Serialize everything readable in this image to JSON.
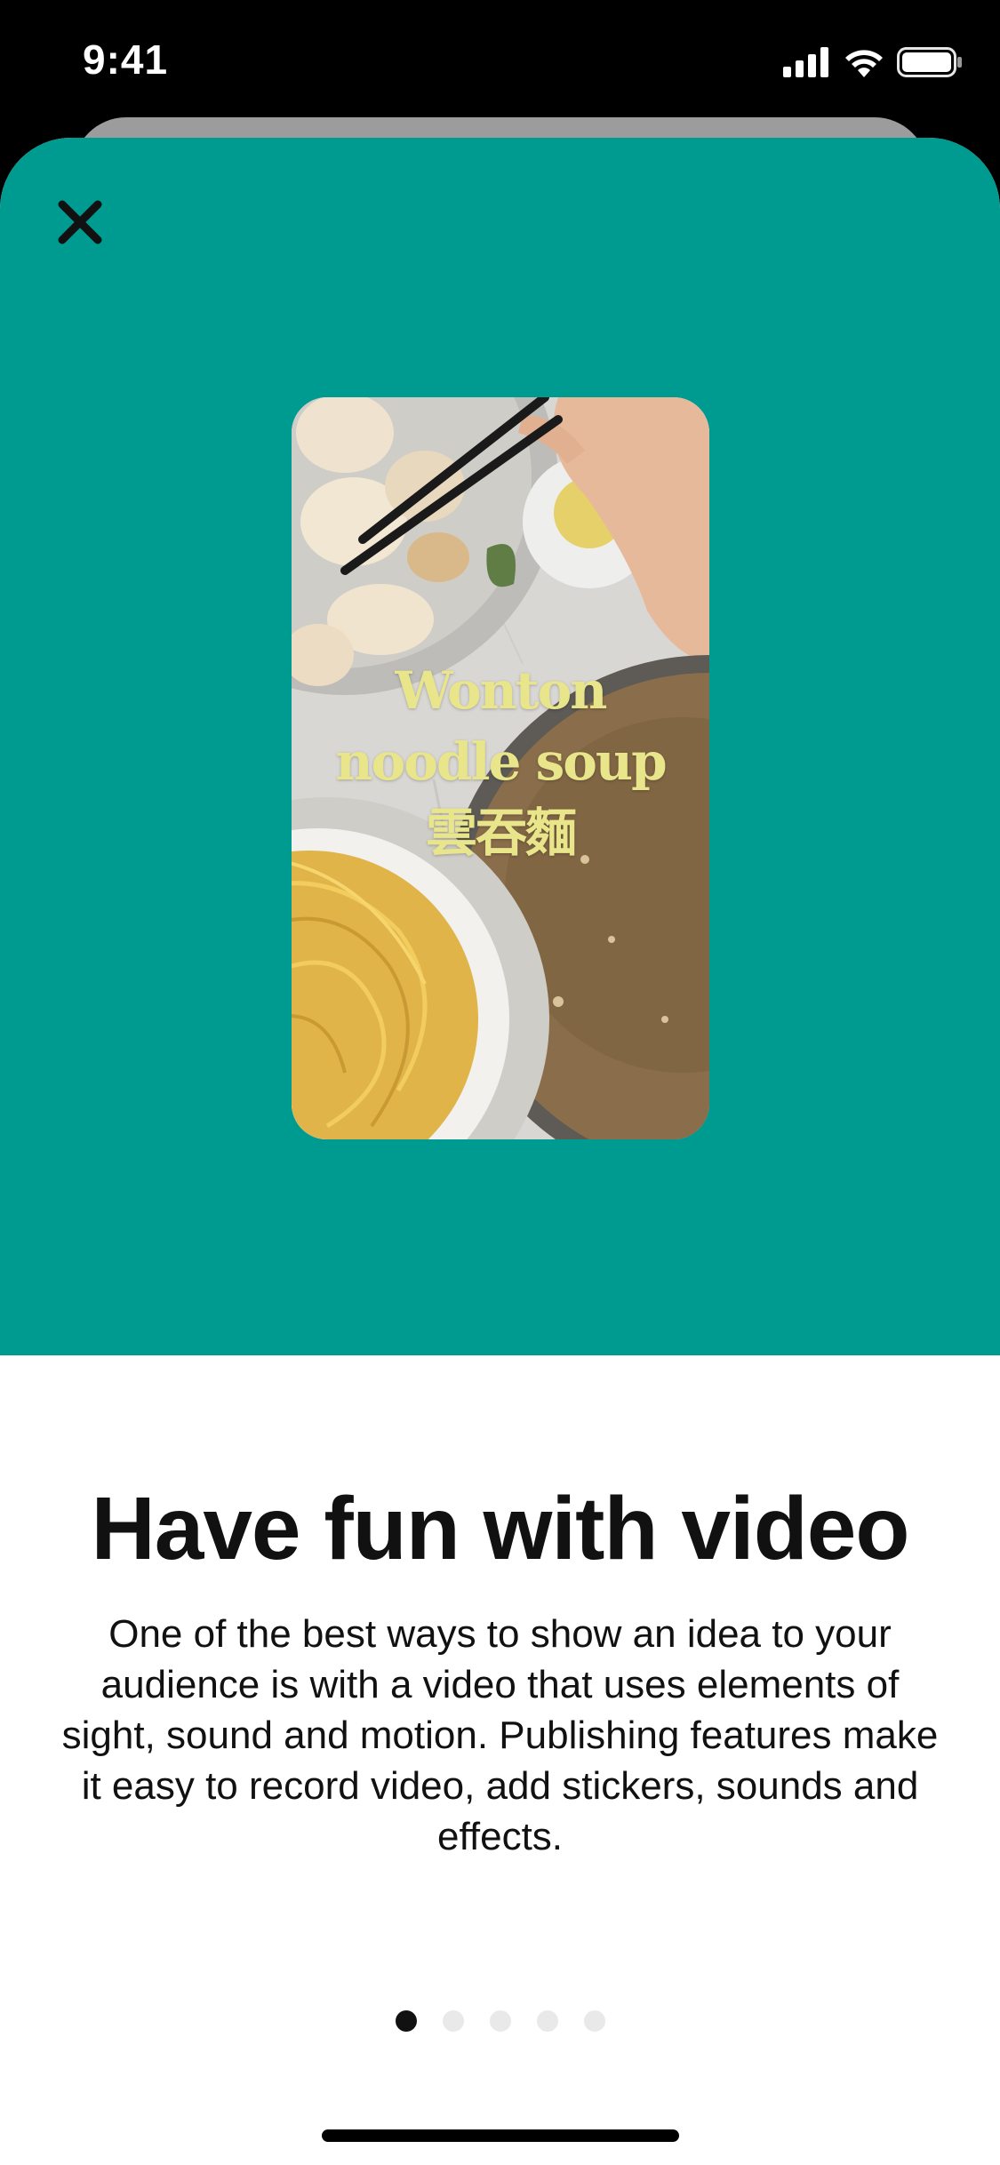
{
  "status_bar": {
    "time": "9:41",
    "icons": [
      "cellular-signal-icon",
      "wifi-icon",
      "battery-icon"
    ]
  },
  "hero": {
    "background_color": "#009b90",
    "close_icon": "close-icon",
    "video_preview": {
      "title_lines": [
        "Wonton",
        "noodle soup",
        "雲吞麵"
      ],
      "title_color": "#e8e58a"
    }
  },
  "content": {
    "headline": "Have fun with video",
    "body": "One of the best ways to show an idea to your audience is with a video that uses elements of sight, sound and motion. Publishing features make it easy to record video, add stickers, sounds and effects."
  },
  "pagination": {
    "total": 5,
    "current": 1
  }
}
